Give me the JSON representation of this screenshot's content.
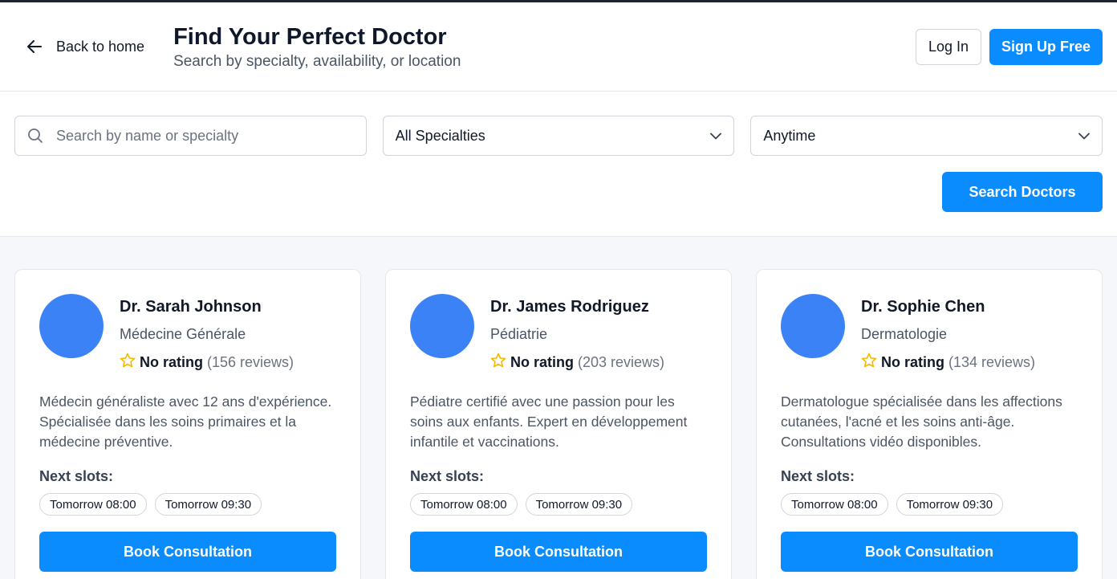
{
  "header": {
    "back_label": "Back to home",
    "title": "Find Your Perfect Doctor",
    "subtitle": "Search by specialty, availability, or location",
    "login_label": "Log In",
    "signup_label": "Sign Up Free"
  },
  "filters": {
    "search_placeholder": "Search by name or specialty",
    "search_value": "",
    "specialty_selected": "All Specialties",
    "time_selected": "Anytime",
    "search_button_label": "Search Doctors"
  },
  "doctors": [
    {
      "name": "Dr. Sarah Johnson",
      "specialty": "Médecine Générale",
      "rating": "No rating",
      "reviews": "(156 reviews)",
      "description": "Médecin généraliste avec 12 ans d'expérience. Spécialisée dans les soins primaires et la médecine préventive.",
      "slots_label": "Next slots:",
      "slots": [
        "Tomorrow 08:00",
        "Tomorrow 09:30"
      ],
      "book_label": "Book Consultation"
    },
    {
      "name": "Dr. James Rodriguez",
      "specialty": "Pédiatrie",
      "rating": "No rating",
      "reviews": "(203 reviews)",
      "description": "Pédiatre certifié avec une passion pour les soins aux enfants. Expert en développement infantile et vaccinations.",
      "slots_label": "Next slots:",
      "slots": [
        "Tomorrow 08:00",
        "Tomorrow 09:30"
      ],
      "book_label": "Book Consultation"
    },
    {
      "name": "Dr. Sophie Chen",
      "specialty": "Dermatologie",
      "rating": "No rating",
      "reviews": "(134 reviews)",
      "description": "Dermatologue spécialisée dans les affections cutanées, l'acné et les soins anti-âge. Consultations vidéo disponibles.",
      "slots_label": "Next slots:",
      "slots": [
        "Tomorrow 08:00",
        "Tomorrow 09:30"
      ],
      "book_label": "Book Consultation"
    }
  ],
  "colors": {
    "primary": "#0a8cff",
    "avatar": "#3b82f6",
    "star": "#f5b800"
  }
}
